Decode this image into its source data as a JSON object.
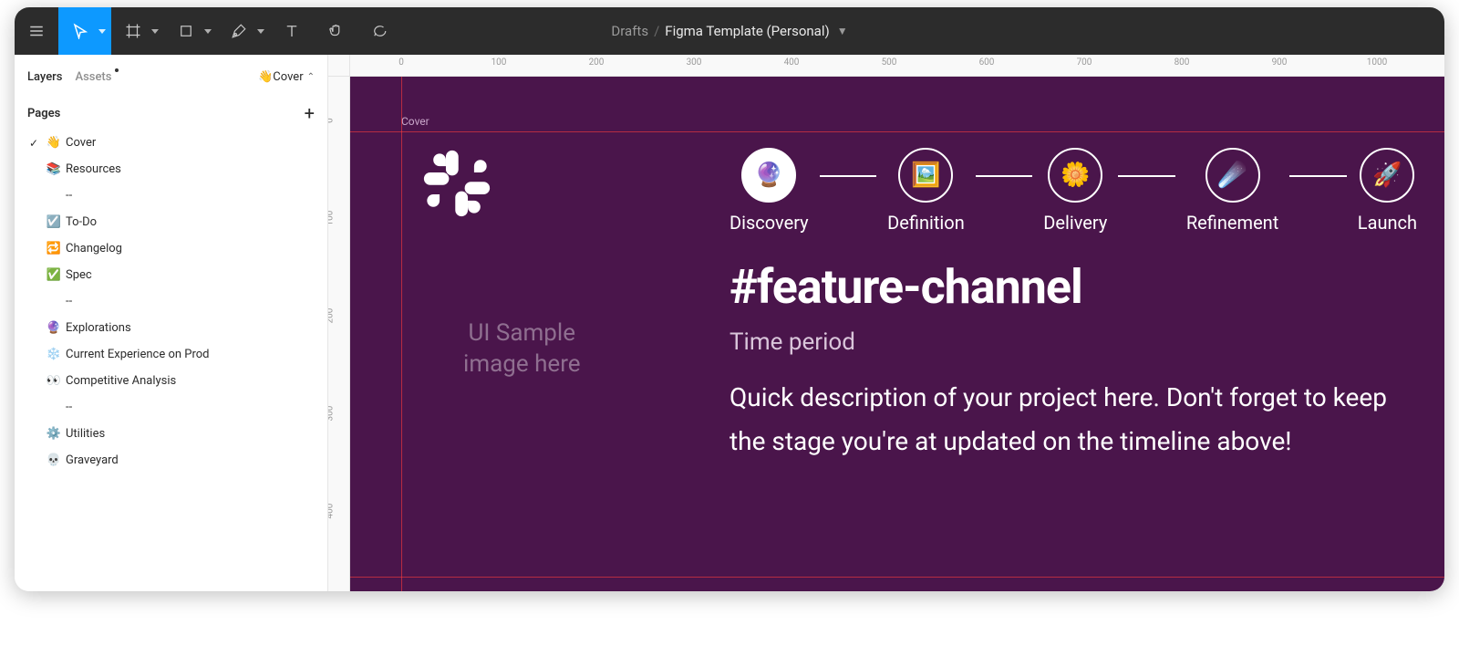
{
  "header": {
    "drafts_label": "Drafts",
    "slash": "/",
    "file_name": "Figma Template (Personal)"
  },
  "left_panel": {
    "tabs": {
      "layers": "Layers",
      "assets": "Assets"
    },
    "page_selector": "👋Cover",
    "pages_header": "Pages",
    "pages": [
      {
        "emoji": "👋",
        "label": "Cover",
        "current": true
      },
      {
        "emoji": "📚",
        "label": "Resources"
      },
      {
        "emoji": "",
        "label": "--"
      },
      {
        "emoji": "☑️",
        "label": "To-Do"
      },
      {
        "emoji": "🔁",
        "label": "Changelog"
      },
      {
        "emoji": "✅",
        "label": "Spec"
      },
      {
        "emoji": "",
        "label": "--"
      },
      {
        "emoji": "🔮",
        "label": "Explorations"
      },
      {
        "emoji": "❄️",
        "label": "Current Experience on Prod"
      },
      {
        "emoji": "👀",
        "label": "Competitive Analysis"
      },
      {
        "emoji": "",
        "label": "--"
      },
      {
        "emoji": "⚙️",
        "label": "Utilities"
      },
      {
        "emoji": "💀",
        "label": "Graveyard"
      }
    ]
  },
  "ruler": {
    "top_ticks": [
      "0",
      "100",
      "200",
      "300",
      "400",
      "500",
      "600",
      "700",
      "800",
      "900",
      "1000"
    ],
    "left_ticks": [
      "0",
      "100",
      "200",
      "300",
      "400"
    ]
  },
  "canvas": {
    "frame_label": "Cover",
    "ui_sample_line1": "UI Sample",
    "ui_sample_line2": "image here",
    "channel_title": "#feature-channel",
    "time_period": "Time period",
    "description": "Quick description of your project here. Don't forget to keep the stage you're at updated on the timeline above!",
    "stages": [
      {
        "emoji": "🔮",
        "label": "Discovery",
        "active": true
      },
      {
        "emoji": "🖼️",
        "label": "Definition",
        "active": false
      },
      {
        "emoji": "🌼",
        "label": "Delivery",
        "active": false
      },
      {
        "emoji": "☄️",
        "label": "Refinement",
        "active": false
      },
      {
        "emoji": "🚀",
        "label": "Launch",
        "active": false
      }
    ]
  }
}
